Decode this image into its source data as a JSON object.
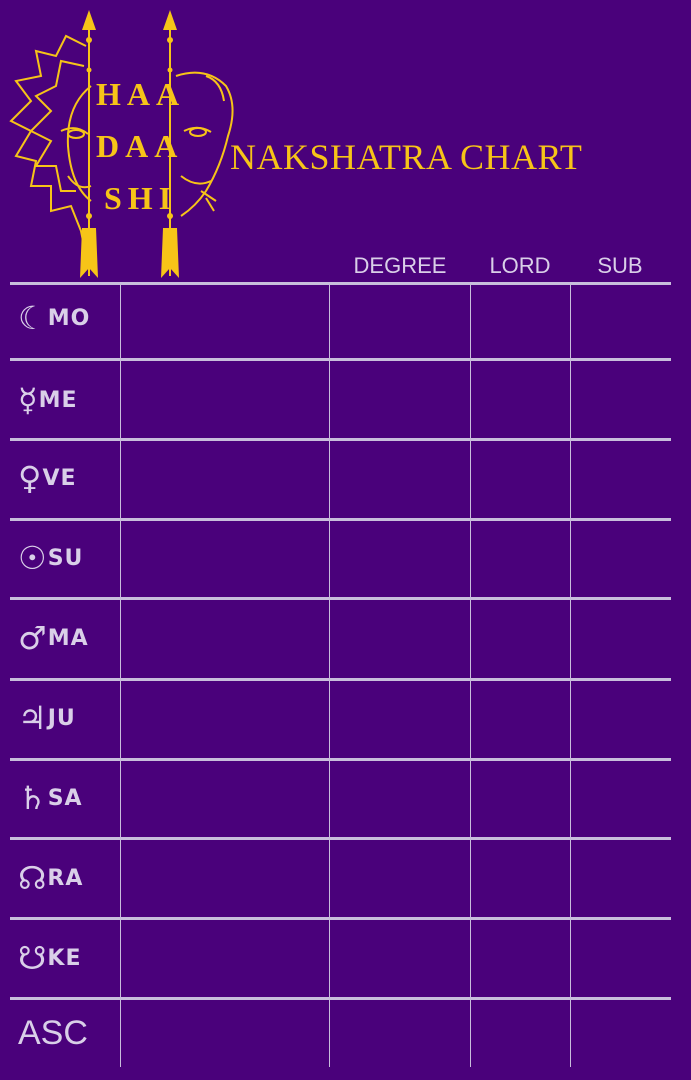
{
  "brand": {
    "logo_words": [
      "HAA",
      "DAA",
      "SHI"
    ]
  },
  "title": "NAKSHATRA CHART",
  "columns": [
    "DEGREE",
    "LORD",
    "SUB"
  ],
  "rows": [
    {
      "symbol": "☾",
      "abbr": "MO"
    },
    {
      "symbol": "☿",
      "abbr": "ME"
    },
    {
      "symbol": "♀",
      "abbr": "VE"
    },
    {
      "symbol": "☉",
      "abbr": "SU"
    },
    {
      "symbol": "♂",
      "abbr": "MA"
    },
    {
      "symbol": "♃",
      "abbr": "JU"
    },
    {
      "symbol": "♄",
      "abbr": "SA"
    },
    {
      "symbol": "☊",
      "abbr": "RA"
    },
    {
      "symbol": "☋",
      "abbr": "KE"
    },
    {
      "symbol": "",
      "abbr": "ASC"
    }
  ],
  "colors": {
    "background": "#4a017b",
    "accent": "#f7c418",
    "line": "#c8bedc",
    "text": "#d9cfe8"
  }
}
